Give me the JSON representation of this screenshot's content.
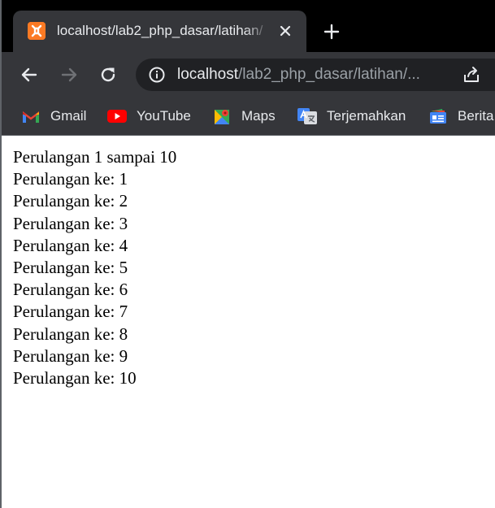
{
  "browser": {
    "tab": {
      "title": "localhost/lab2_php_dasar/latihan/",
      "favicon": "xampp-icon",
      "favicon_color": "#fb7a24"
    },
    "new_tab_icon": "plus-icon",
    "toolbar": {
      "back_icon": "back-arrow-icon",
      "forward_icon": "forward-arrow-icon",
      "reload_icon": "reload-icon",
      "url_host": "localhost",
      "url_path": "/lab2_php_dasar/latihan/...",
      "site_info_icon": "info-icon",
      "share_icon": "share-icon"
    },
    "bookmarks": [
      {
        "label": "Gmail",
        "icon": "gmail-icon"
      },
      {
        "label": "YouTube",
        "icon": "youtube-icon"
      },
      {
        "label": "Maps",
        "icon": "maps-icon"
      },
      {
        "label": "Terjemahkan",
        "icon": "translate-icon"
      },
      {
        "label": "Berita",
        "icon": "news-icon"
      }
    ],
    "colors": {
      "tabstrip": "#000000",
      "toolbar": "#35363a",
      "omnibox": "#202124",
      "text": "#e8eaed",
      "muted_text": "#9aa0a6"
    }
  },
  "page": {
    "heading": "Perulangan 1 sampai 10",
    "lines": [
      "Perulangan ke: 1",
      "Perulangan ke: 2",
      "Perulangan ke: 3",
      "Perulangan ke: 4",
      "Perulangan ke: 5",
      "Perulangan ke: 6",
      "Perulangan ke: 7",
      "Perulangan ke: 8",
      "Perulangan ke: 9",
      "Perulangan ke: 10"
    ]
  }
}
